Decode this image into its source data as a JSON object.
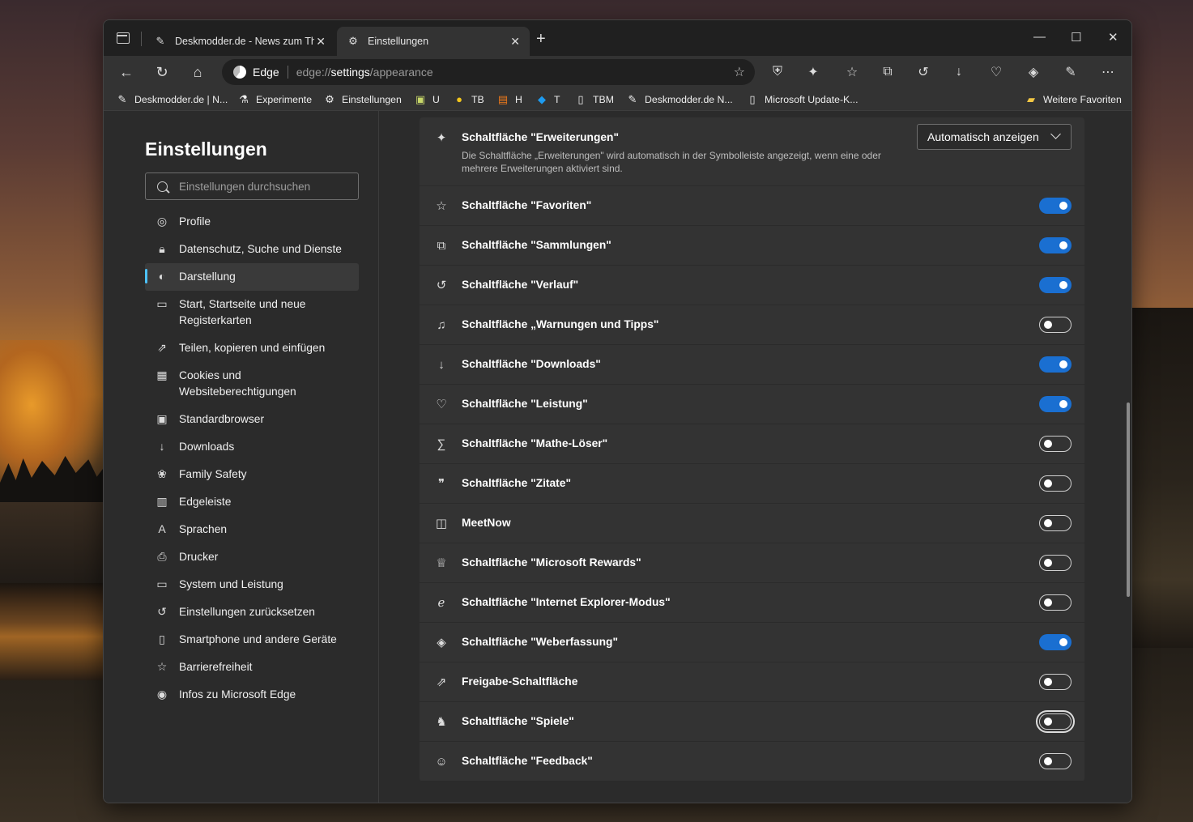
{
  "tabs": [
    {
      "title": "Deskmodder.de - News zum The",
      "active": false
    },
    {
      "title": "Einstellungen",
      "active": true
    }
  ],
  "addressbar": {
    "label": "Edge",
    "url_prefix": "edge://",
    "url_host": "settings",
    "url_path": "/appearance"
  },
  "favorites": [
    {
      "label": "Deskmodder.de | N...",
      "icon": "pen-icon"
    },
    {
      "label": "Experimente",
      "icon": "flask-icon"
    },
    {
      "label": "Einstellungen",
      "icon": "gear-icon"
    },
    {
      "label": "U",
      "icon": "badge-icon"
    },
    {
      "label": "TB",
      "icon": "coin-icon"
    },
    {
      "label": "H",
      "icon": "stack-icon"
    },
    {
      "label": "T",
      "icon": "twitter-icon"
    },
    {
      "label": "TBM",
      "icon": "page-icon"
    },
    {
      "label": "Deskmodder.de N...",
      "icon": "pen-icon"
    },
    {
      "label": "Microsoft Update-K...",
      "icon": "page-icon"
    },
    {
      "label": "Weitere Favoriten",
      "icon": "folder-icon"
    }
  ],
  "sidebar": {
    "title": "Einstellungen",
    "search_placeholder": "Einstellungen durchsuchen",
    "items": [
      {
        "label": "Profile",
        "icon": "profile-icon"
      },
      {
        "label": "Datenschutz, Suche und Dienste",
        "icon": "lock-icon"
      },
      {
        "label": "Darstellung",
        "icon": "palette-icon",
        "selected": true
      },
      {
        "label": "Start, Startseite und neue Registerkarten",
        "icon": "home-tab-icon"
      },
      {
        "label": "Teilen, kopieren und einfügen",
        "icon": "share-icon"
      },
      {
        "label": "Cookies und Websiteberechtigungen",
        "icon": "cookie-icon"
      },
      {
        "label": "Standardbrowser",
        "icon": "browser-icon"
      },
      {
        "label": "Downloads",
        "icon": "download-icon"
      },
      {
        "label": "Family Safety",
        "icon": "family-icon"
      },
      {
        "label": "Edgeleiste",
        "icon": "sidebar-icon"
      },
      {
        "label": "Sprachen",
        "icon": "language-icon"
      },
      {
        "label": "Drucker",
        "icon": "printer-icon"
      },
      {
        "label": "System und Leistung",
        "icon": "laptop-icon"
      },
      {
        "label": "Einstellungen zurücksetzen",
        "icon": "reset-icon"
      },
      {
        "label": "Smartphone und andere Geräte",
        "icon": "phone-icon"
      },
      {
        "label": "Barrierefreiheit",
        "icon": "accessibility-icon"
      },
      {
        "label": "Infos zu Microsoft Edge",
        "icon": "edge-icon"
      }
    ]
  },
  "settings": {
    "extensions": {
      "label": "Schaltfläche \"Erweiterungen\"",
      "description": "Die Schaltfläche „Erweiterungen\" wird automatisch in der Symbolleiste angezeigt, wenn eine oder mehrere Erweiterungen aktiviert sind.",
      "dropdown_value": "Automatisch anzeigen"
    },
    "rows": [
      {
        "label": "Schaltfläche \"Favoriten\"",
        "icon": "favorites-icon",
        "on": true
      },
      {
        "label": "Schaltfläche \"Sammlungen\"",
        "icon": "collections-icon",
        "on": true
      },
      {
        "label": "Schaltfläche \"Verlauf\"",
        "icon": "history-icon",
        "on": true
      },
      {
        "label": "Schaltfläche „Warnungen und Tipps\"",
        "icon": "bell-icon",
        "on": false
      },
      {
        "label": "Schaltfläche \"Downloads\"",
        "icon": "download-icon",
        "on": true
      },
      {
        "label": "Schaltfläche \"Leistung\"",
        "icon": "heartbeat-icon",
        "on": true
      },
      {
        "label": "Schaltfläche \"Mathe-Löser\"",
        "icon": "math-icon",
        "on": false
      },
      {
        "label": "Schaltfläche \"Zitate\"",
        "icon": "quote-icon",
        "on": false
      },
      {
        "label": "MeetNow",
        "icon": "camera-icon",
        "on": false
      },
      {
        "label": "Schaltfläche \"Microsoft Rewards\"",
        "icon": "trophy-icon",
        "on": false
      },
      {
        "label": "Schaltfläche \"Internet Explorer-Modus\"",
        "icon": "ie-icon",
        "on": false
      },
      {
        "label": "Schaltfläche \"Weberfassung\"",
        "icon": "capture-icon",
        "on": true
      },
      {
        "label": "Freigabe-Schaltfläche",
        "icon": "share-icon",
        "on": false
      },
      {
        "label": "Schaltfläche \"Spiele\"",
        "icon": "games-icon",
        "on": false,
        "focused": true
      },
      {
        "label": "Schaltfläche \"Feedback\"",
        "icon": "feedback-icon",
        "on": false
      }
    ]
  }
}
